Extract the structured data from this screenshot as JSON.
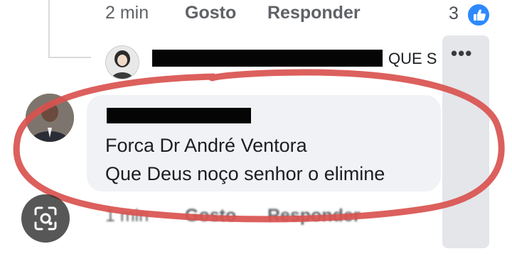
{
  "previous_comment": {
    "time": "2 min",
    "like_label": "Gosto",
    "reply_label": "Responder",
    "reaction_count": "3",
    "reaction_icon": "thumbs-up-icon"
  },
  "reply_preview": {
    "text_tail": "QUE S",
    "more_icon": "more-dots-icon"
  },
  "comment": {
    "lines": [
      "Forca Dr André Ventora",
      "Que Deus noço senhor o elimine"
    ],
    "time": "1 min",
    "like_label": "Gosto",
    "reply_label": "Responder"
  },
  "overlay": {
    "visual_search_icon": "lens-search-icon"
  },
  "colors": {
    "bubble": "#f0f2f5",
    "meta_text": "#5f6266",
    "like_blue": "#2d88ff",
    "annotation_red": "#d9534f",
    "redaction": "#050505"
  }
}
